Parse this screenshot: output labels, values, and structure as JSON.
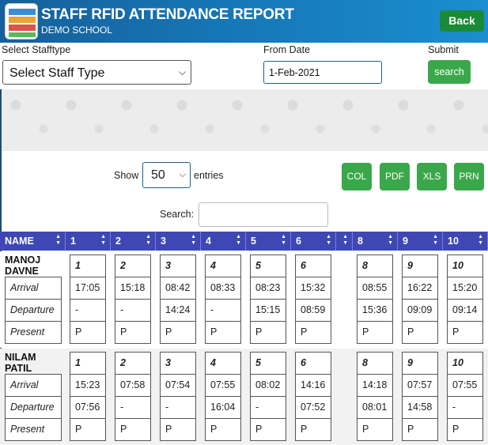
{
  "header": {
    "title": "STAFF RFID ATTENDANCE REPORT",
    "subtitle": "DEMO SCHOOL",
    "back_label": "Back"
  },
  "filters": {
    "stafftype_label": "Select Stafftype",
    "stafftype_value": "Select Staff Type",
    "fromdate_label": "From Date",
    "fromdate_value": "1-Feb-2021",
    "submit_label": "Submit",
    "search_label": "search"
  },
  "table_controls": {
    "show_label": "Show",
    "entries_value": "50",
    "entries_label": "entries",
    "search_label": "Search:",
    "export_buttons": [
      "COL",
      "PDF",
      "XLS",
      "PRN"
    ]
  },
  "table": {
    "columns": [
      "NAME",
      "1",
      "2",
      "3",
      "4",
      "5",
      "6",
      "",
      "8",
      "9",
      "10"
    ],
    "row_labels": [
      "Arrival",
      "Departure",
      "Present"
    ],
    "rows": [
      {
        "name": "MANOJ DAVNE",
        "days": [
          {
            "day": "1",
            "arrival": "17:05",
            "departure": "-",
            "present": "P"
          },
          {
            "day": "2",
            "arrival": "15:18",
            "departure": "-",
            "present": "P"
          },
          {
            "day": "3",
            "arrival": "08:42",
            "departure": "14:24",
            "present": "P"
          },
          {
            "day": "4",
            "arrival": "08:33",
            "departure": "-",
            "present": "P"
          },
          {
            "day": "5",
            "arrival": "08:23",
            "departure": "15:15",
            "present": "P"
          },
          {
            "day": "6",
            "arrival": "15:32",
            "departure": "08:59",
            "present": "P"
          },
          {
            "day": "8",
            "arrival": "08:55",
            "departure": "15:36",
            "present": "P"
          },
          {
            "day": "9",
            "arrival": "16:22",
            "departure": "09:09",
            "present": "P"
          },
          {
            "day": "10",
            "arrival": "15:20",
            "departure": "09:14",
            "present": "P"
          }
        ]
      },
      {
        "name": "NILAM PATIL",
        "days": [
          {
            "day": "1",
            "arrival": "15:23",
            "departure": "07:56",
            "present": "P"
          },
          {
            "day": "2",
            "arrival": "07:58",
            "departure": "-",
            "present": "P"
          },
          {
            "day": "3",
            "arrival": "07:54",
            "departure": "-",
            "present": "P"
          },
          {
            "day": "4",
            "arrival": "07:55",
            "departure": "16:04",
            "present": "P"
          },
          {
            "day": "5",
            "arrival": "08:02",
            "departure": "-",
            "present": "P"
          },
          {
            "day": "6",
            "arrival": "14:16",
            "departure": "07:52",
            "present": "P"
          },
          {
            "day": "8",
            "arrival": "14:18",
            "departure": "08:01",
            "present": "P"
          },
          {
            "day": "9",
            "arrival": "07:57",
            "departure": "14:58",
            "present": "P"
          },
          {
            "day": "10",
            "arrival": "07:55",
            "departure": "-",
            "present": "P"
          }
        ]
      }
    ]
  }
}
